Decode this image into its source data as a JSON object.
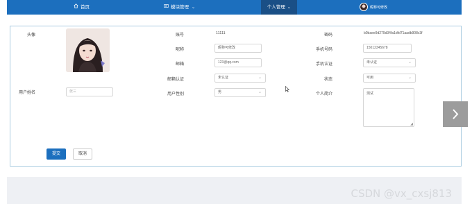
{
  "nav": {
    "home_label": "首页",
    "modules_label": "模块管理",
    "personal_label": "个人管理",
    "user_name": "昵称可修改"
  },
  "form": {
    "avatar_label": "头像",
    "account_label": "账号",
    "account_value": "11111",
    "password_label": "密码",
    "password_value": "b0baee9d279d34fa1dfd71aadb908c3f",
    "nickname_label": "昵称",
    "nickname_value": "昵称可修改",
    "phone_label": "手机号码",
    "phone_value": "15012345678",
    "email_label": "邮箱",
    "email_value": "123@qq.com",
    "phone_verify_label": "手机认证",
    "phone_verify_value": "未认证",
    "email_verify_label": "邮箱认证",
    "email_verify_value": "未认证",
    "status_label": "状态",
    "status_value": "可用",
    "realname_label": "用户姓名",
    "realname_placeholder": "张三",
    "gender_label": "用户性别",
    "gender_value": "男",
    "intro_label": "个人简介",
    "intro_value": "测试"
  },
  "actions": {
    "submit_label": "提交",
    "cancel_label": "取消"
  },
  "watermark": "CSDN @vx_cxsj813"
}
